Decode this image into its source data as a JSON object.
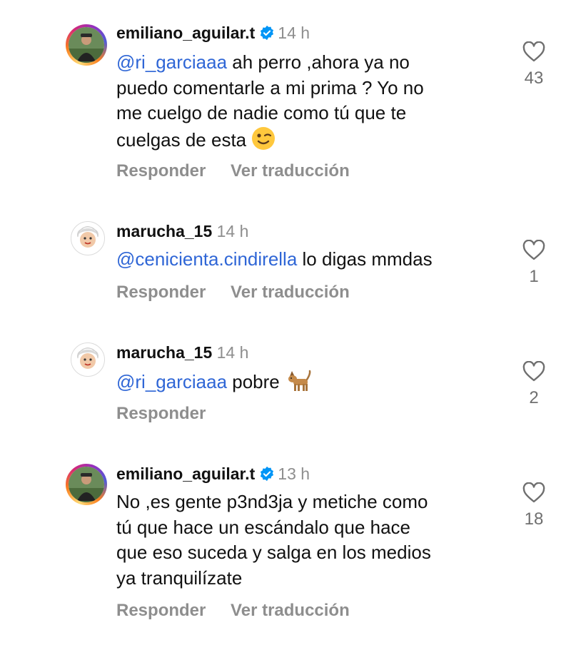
{
  "comments": [
    {
      "username": "emiliano_aguilar.t",
      "verified": true,
      "time": "14 h",
      "mention": "@ri_garciaaa",
      "text_lines": [
        " ah perro ,ahora ya no",
        "puedo comentarle a mi prima ? Yo no",
        "me cuelgo de nadie como tú que te",
        "cuelgas de esta "
      ],
      "emoji": "winking-face",
      "actions": [
        "Responder",
        "Ver traducción"
      ],
      "likes": "43"
    },
    {
      "username": "marucha_15",
      "verified": false,
      "time": "14 h",
      "mention": "@cenicienta.cindirella",
      "text_lines": [
        " lo digas mmdas"
      ],
      "actions": [
        "Responder",
        "Ver traducción"
      ],
      "likes": "1"
    },
    {
      "username": "marucha_15",
      "verified": false,
      "time": "14 h",
      "mention": "@ri_garciaaa",
      "text_lines": [
        " pobre "
      ],
      "emoji": "dog",
      "actions": [
        "Responder"
      ],
      "likes": "2"
    },
    {
      "username": "emiliano_aguilar.t",
      "verified": true,
      "time": "13 h",
      "mention": "",
      "text_lines": [
        "No ,es gente p3nd3ja y metiche como",
        "tú que hace un escándalo que hace",
        "que eso suceda y salga en los medios",
        "ya tranquilízate"
      ],
      "actions": [
        "Responder",
        "Ver traducción"
      ],
      "likes": "18"
    }
  ],
  "colors": {
    "mention": "#2f66d6",
    "muted": "#8e8e8e",
    "verified": "#0095f6"
  }
}
